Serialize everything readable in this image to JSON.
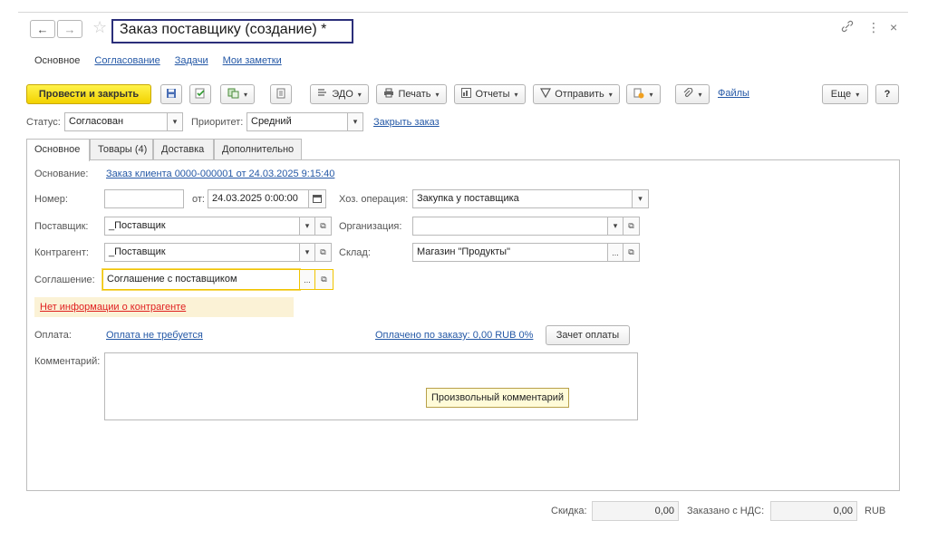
{
  "window": {
    "title": "Заказ поставщику (создание) *",
    "back_glyph": "←",
    "forward_glyph": "→",
    "star_glyph": "☆",
    "link_glyph": "🔗",
    "more_glyph": "⋮",
    "close_glyph": "×"
  },
  "sections": [
    {
      "label": "Основное"
    },
    {
      "label": "Согласование"
    },
    {
      "label": "Задачи"
    },
    {
      "label": "Мои заметки"
    }
  ],
  "toolbar": {
    "post_close_label": "Провести и закрыть",
    "edo_label": "ЭДО",
    "print_label": "Печать",
    "reports_label": "Отчеты",
    "send_label": "Отправить",
    "files_label": "Файлы",
    "more_label": "Еще",
    "help_label": "?",
    "dropdown_glyph": "▾",
    "icons": [
      "save-icon",
      "post-icon",
      "create-based-on-icon",
      "document-journal-icon",
      "edo-icon",
      "print-icon",
      "reports-icon",
      "send-icon",
      "attach-icon"
    ]
  },
  "header": {
    "status_label": "Статус:",
    "status_value": "Согласован",
    "priority_label": "Приоритет:",
    "priority_value": "Средний",
    "close_order_link": "Закрыть заказ"
  },
  "tabs": [
    {
      "label": "Основное"
    },
    {
      "label": "Товары (4)"
    },
    {
      "label": "Доставка"
    },
    {
      "label": "Дополнительно"
    }
  ],
  "form": {
    "basis_label": "Основание:",
    "basis_link": "Заказ клиента 0000-000001 от 24.03.2025 9:15:40",
    "number_label": "Номер:",
    "number_value": "",
    "from_label": "от:",
    "date_value": "24.03.2025  0:00:00",
    "operation_label": "Хоз. операция:",
    "operation_value": "Закупка у поставщика",
    "supplier_label": "Поставщик:",
    "supplier_value": "_Поставщик",
    "organization_label": "Организация:",
    "organization_value": "",
    "counterparty_label": "Контрагент:",
    "counterparty_value": "_Поставщик",
    "warehouse_label": "Склад:",
    "warehouse_value": "Магазин \"Продукты\"",
    "agreement_label": "Соглашение:",
    "agreement_value": "Соглашение с поставщиком",
    "warning_link": "Нет информации о контрагенте",
    "payment_label": "Оплата:",
    "payment_link": "Оплата не требуется",
    "paid_link": "Оплачено по заказу: 0,00 RUB 0%",
    "offset_button": "Зачет оплаты",
    "comment_label": "Комментарий:",
    "comment_value": "",
    "comment_tooltip": "Произвольный комментарий",
    "select_glyph": "...",
    "open_glyph": "⧉",
    "calendar_glyph": "▦"
  },
  "footer": {
    "discount_label": "Скидка:",
    "discount_value": "0,00",
    "ordered_vat_label": "Заказано с НДС:",
    "ordered_vat_value": "0,00",
    "currency": "RUB"
  },
  "colors": {
    "accent_yellow": "#f5d800",
    "link_blue": "#2458a6",
    "warning_red": "#e02020",
    "title_border": "#2b2f7a"
  }
}
